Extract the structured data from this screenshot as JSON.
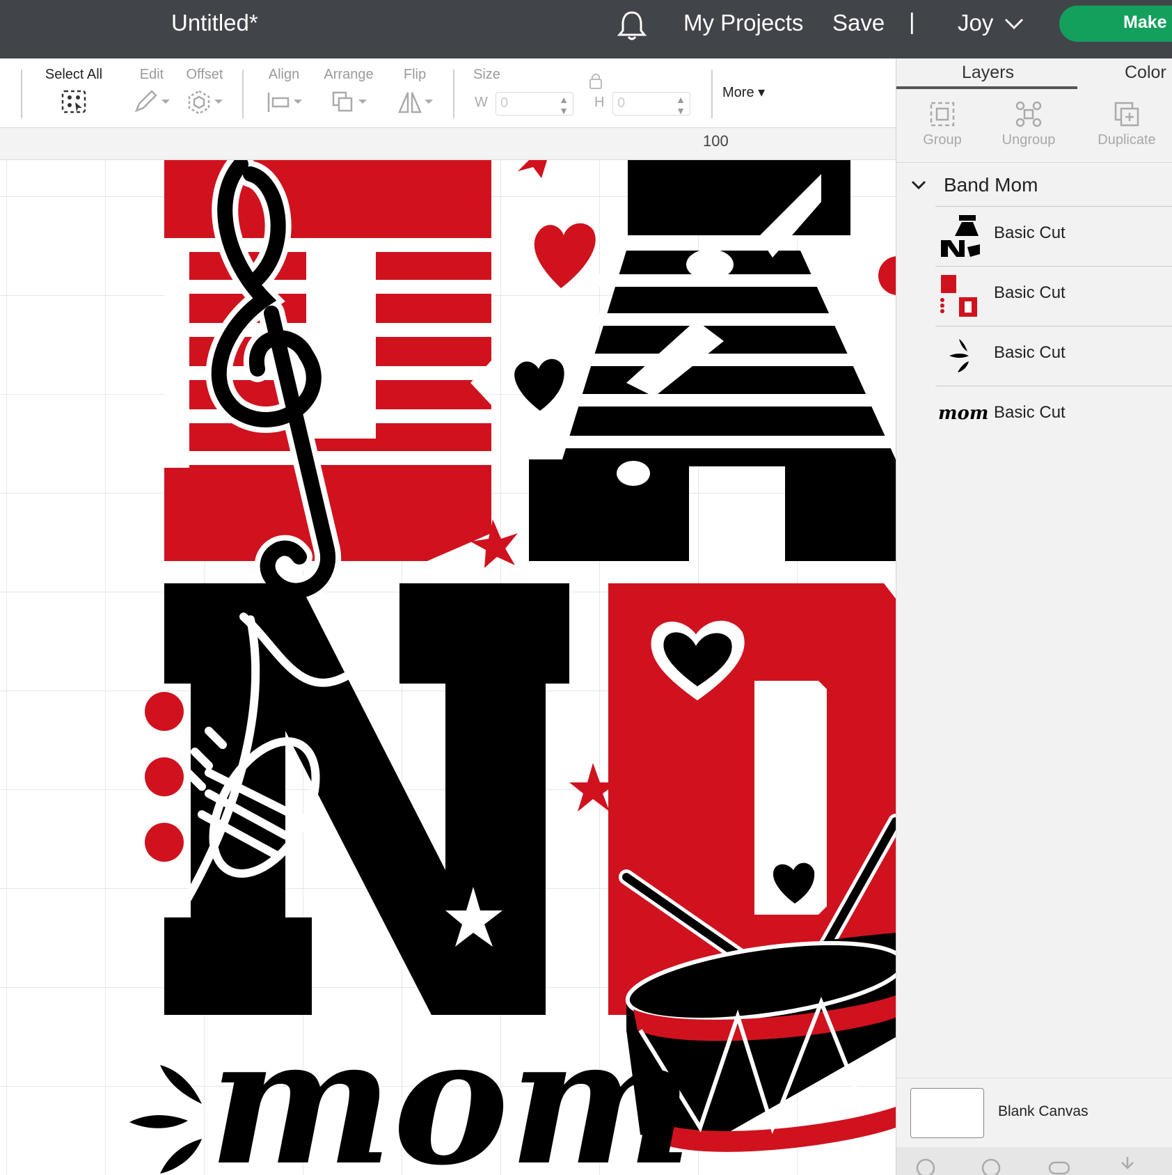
{
  "topbar": {
    "title": "Untitled*",
    "bell_icon": "bell-icon",
    "my_projects": "My Projects",
    "save": "Save",
    "separator": "|",
    "user": "Joy",
    "make": "Make I"
  },
  "toolbar": {
    "select_all": "Select All",
    "edit": "Edit",
    "offset": "Offset",
    "align": "Align",
    "arrange": "Arrange",
    "flip": "Flip",
    "size": "Size",
    "w_label": "W",
    "h_label": "H",
    "w_value": "0",
    "h_value": "0",
    "more": "More"
  },
  "canvas": {
    "ruler_mark": "100",
    "design_script_word": "mom"
  },
  "panel": {
    "tab_layers": "Layers",
    "tab_color": "Color",
    "group": "Group",
    "ungroup": "Ungroup",
    "duplicate": "Duplicate",
    "group_name": "Band Mom",
    "layers": [
      {
        "name": "Basic Cut",
        "thumb": "black-letters-thumb"
      },
      {
        "name": "Basic Cut",
        "thumb": "red-letters-thumb"
      },
      {
        "name": "Basic Cut",
        "thumb": "splash-marks-thumb"
      },
      {
        "name": "Basic Cut",
        "thumb": "mom-script-thumb",
        "thumb_text": "mom"
      }
    ],
    "blank_canvas": "Blank Canvas"
  },
  "colors": {
    "topbar_bg": "#414549",
    "make_button": "#12a05c",
    "design_red": "#d0121e",
    "design_black": "#000000"
  }
}
